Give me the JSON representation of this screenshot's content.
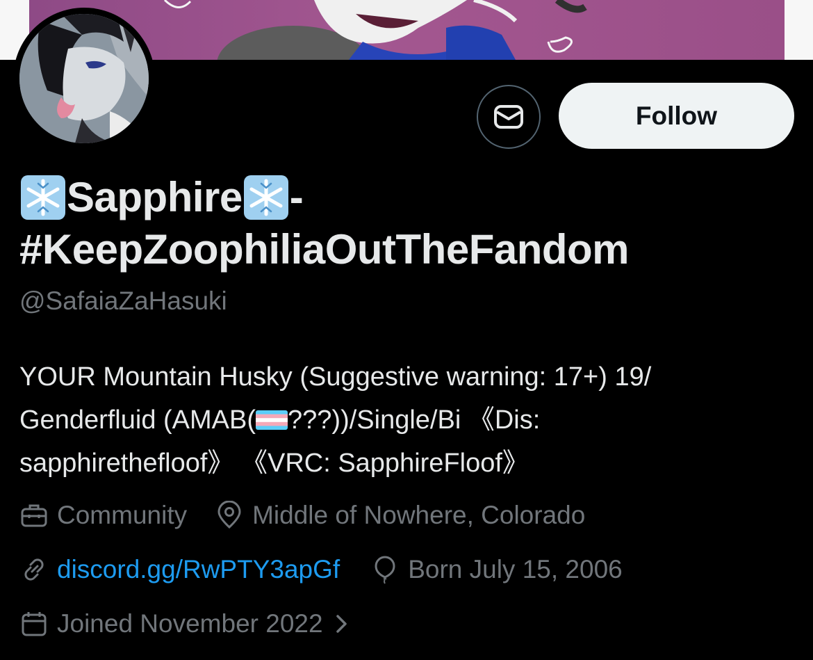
{
  "profile": {
    "name_part1": "Sapphire",
    "name_separator": " -",
    "name_part2": "#KeepZoophiliaOutTheFandom",
    "name_emoji": "snowflake-emoji",
    "handle": "@SafaiaZaHasuki",
    "bio": {
      "line1": "YOUR Mountain Husky (Suggestive warning: 17+) 19/",
      "line2_a": "Genderfluid (AMAB(",
      "line2_flag": "transgender-flag-emoji",
      "line2_b": "???))/Single/Bi 《Dis:",
      "line3": "sapphirethefloof》 《VRC: SapphireFloof》"
    },
    "category": "Community",
    "location": "Middle of Nowhere, Colorado",
    "website": "discord.gg/RwPTY3apGf",
    "birthday": "Born July 15, 2006",
    "joined": "Joined November 2022"
  },
  "actions": {
    "follow_label": "Follow",
    "message_icon": "mail-icon"
  },
  "icons": {
    "category": "briefcase-icon",
    "location": "location-pin-icon",
    "website": "link-icon",
    "birthday": "balloon-icon",
    "joined": "calendar-icon",
    "joined_more": "chevron-right-icon"
  },
  "colors": {
    "background": "#000000",
    "primary_text": "#e7e9ea",
    "secondary_text": "#71767b",
    "link": "#1d9bf0",
    "follow_bg": "#eff3f4"
  }
}
